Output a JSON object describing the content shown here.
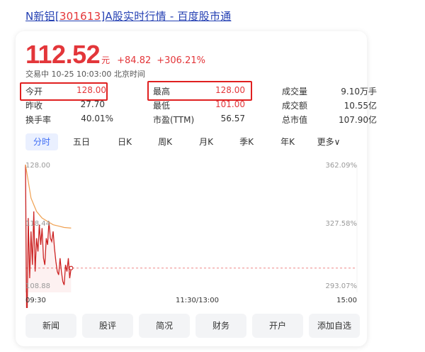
{
  "headline": {
    "prefix": "N新铝[",
    "code": "301613",
    "suffix": "]A股实时行情 - 百度股市通"
  },
  "quote": {
    "price": "112.52",
    "unit": "元",
    "change": "+84.82",
    "change_pct": "+306.21%",
    "status": "交易中 10-25 10:03:00 北京时间"
  },
  "stats": [
    {
      "label": "今开",
      "value": "128.00",
      "color": "#e3363a"
    },
    {
      "label": "最高",
      "value": "128.00",
      "color": "#e3363a"
    },
    {
      "label": "成交量",
      "value": "9.10万手",
      "color": "#333333"
    },
    {
      "label": "昨收",
      "value": "27.70",
      "color": "#333333"
    },
    {
      "label": "最低",
      "value": "101.00",
      "color": "#e3363a"
    },
    {
      "label": "成交额",
      "value": "10.55亿",
      "color": "#333333"
    },
    {
      "label": "换手率",
      "value": "40.01%",
      "color": "#333333"
    },
    {
      "label": "市盈(TTM)",
      "value": "56.57",
      "color": "#333333"
    },
    {
      "label": "总市值",
      "value": "107.90亿",
      "color": "#333333"
    }
  ],
  "tabs": [
    "分时",
    "五日",
    "日K",
    "周K",
    "月K",
    "季K",
    "年K",
    "更多∨"
  ],
  "active_tab": 0,
  "chart": {
    "y_left": [
      "128.00",
      "118.44",
      "108.88"
    ],
    "y_right": [
      "362.09%",
      "327.58%",
      "293.07%"
    ],
    "x_labels": [
      "09:30",
      "11:30/13:00",
      "15:00"
    ],
    "reference_line": "112.52"
  },
  "chart_data": {
    "type": "line",
    "title": "",
    "xlabel": "",
    "ylabel": "",
    "xticks": [
      "09:30",
      "11:30/13:00",
      "15:00"
    ],
    "ylim": [
      108.88,
      128.0
    ],
    "ylim_pct": [
      293.07,
      362.09
    ],
    "series": [
      {
        "name": "",
        "color": "#cc2222",
        "x_minutes": [
          0,
          1,
          2,
          3,
          4,
          5,
          6,
          7,
          8,
          9,
          10,
          11,
          12,
          13,
          14,
          15,
          16,
          17,
          18,
          19,
          20,
          21,
          22,
          23,
          24,
          25,
          26,
          27,
          28,
          29,
          30,
          31,
          32,
          33
        ],
        "values": [
          128.0,
          101.0,
          120.0,
          111.0,
          118.0,
          113.0,
          121.0,
          112.0,
          117.0,
          115.0,
          119.0,
          116.0,
          118.5,
          114.0,
          113.0,
          117.0,
          116.0,
          119.5,
          117.0,
          116.5,
          118.0,
          115.5,
          113.5,
          112.0,
          111.5,
          114.0,
          112.0,
          110.5,
          110.0,
          113.0,
          112.0,
          114.0,
          111.0,
          112.52
        ]
      },
      {
        "name": "",
        "color": "#f0a050",
        "x_minutes": [
          0,
          4,
          8,
          12,
          16,
          20,
          24,
          28,
          33
        ],
        "values": [
          128.0,
          123.0,
          121.0,
          120.0,
          119.5,
          119.0,
          118.8,
          118.6,
          118.5
        ]
      }
    ]
  },
  "buttons": [
    "新闻",
    "股评",
    "简况",
    "财务",
    "开户",
    "添加自选"
  ]
}
